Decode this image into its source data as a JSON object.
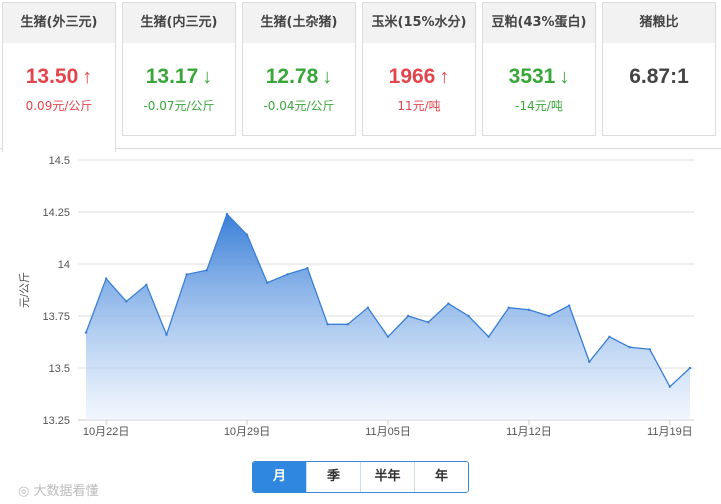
{
  "cards": [
    {
      "title": "生猪(外三元)",
      "price": "13.50",
      "arrow": "↑",
      "change": "0.09元/公斤",
      "trend": "up"
    },
    {
      "title": "生猪(内三元)",
      "price": "13.17",
      "arrow": "↓",
      "change": "-0.07元/公斤",
      "trend": "down"
    },
    {
      "title": "生猪(土杂猪)",
      "price": "12.78",
      "arrow": "↓",
      "change": "-0.04元/公斤",
      "trend": "down"
    },
    {
      "title": "玉米(15%水分)",
      "price": "1966",
      "arrow": "↑",
      "change": "11元/吨",
      "trend": "up"
    },
    {
      "title": "豆粕(43%蛋白)",
      "price": "3531",
      "arrow": "↓",
      "change": "-14元/吨",
      "trend": "down"
    },
    {
      "title": "猪粮比",
      "price": "6.87:1",
      "arrow": "",
      "change": "",
      "trend": "neutral"
    }
  ],
  "range_buttons": [
    "月",
    "季",
    "半年",
    "年"
  ],
  "watermark": "大数据看懂",
  "chart_data": {
    "type": "area",
    "ylabel": "元/公斤",
    "ylim": [
      13.25,
      14.5
    ],
    "yticks": [
      "13.25",
      "13.5",
      "13.75",
      "14",
      "14.25",
      "14.5"
    ],
    "xticks": [
      "10月22日",
      "10月29日",
      "11月05日",
      "11月12日",
      "11月19日"
    ],
    "grid": true,
    "color": "#3a7fd4",
    "series": [
      {
        "values": [
          13.67,
          13.93,
          13.82,
          13.9,
          13.66,
          13.95,
          13.97,
          14.24,
          14.14,
          13.91,
          13.95,
          13.98,
          13.71,
          13.71,
          13.79,
          13.65,
          13.75,
          13.72,
          13.81,
          13.75,
          13.65,
          13.79,
          13.78,
          13.75,
          13.8,
          13.53,
          13.65,
          13.6,
          13.59,
          13.41,
          13.5
        ]
      }
    ]
  }
}
